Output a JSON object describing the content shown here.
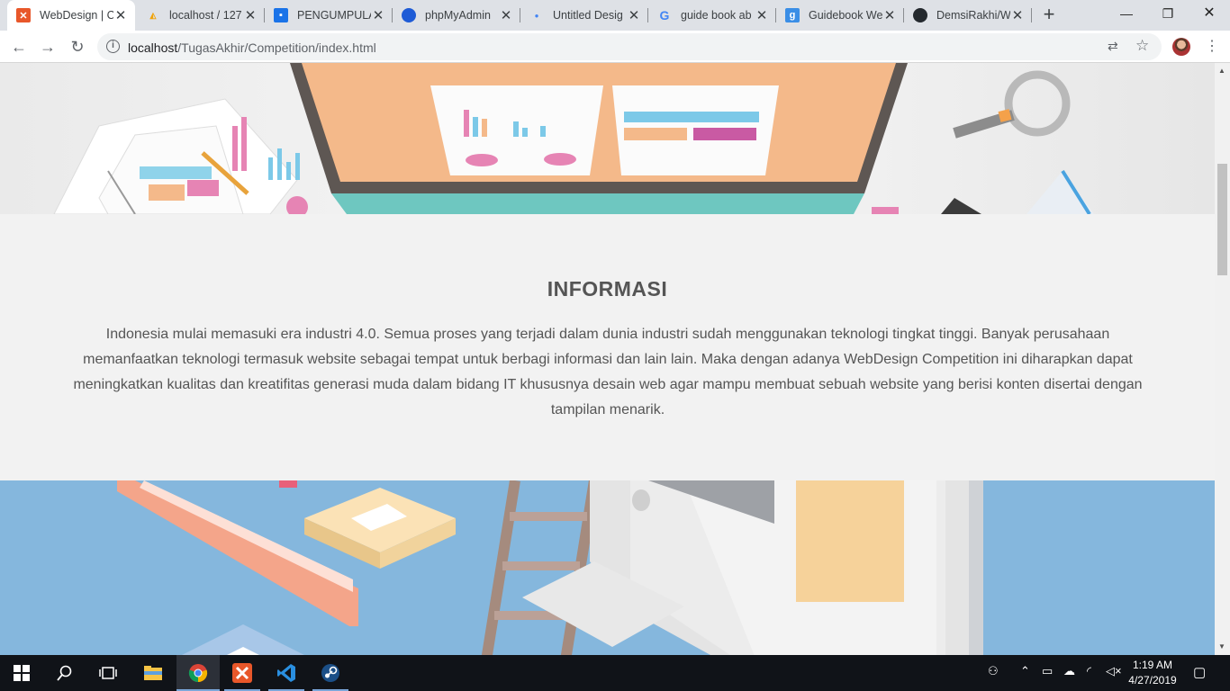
{
  "browser": {
    "tabs": [
      {
        "title": "WebDesign | C",
        "favicon": "xampp-icon",
        "color": "#e8572a"
      },
      {
        "title": "localhost / 127",
        "favicon": "phpmyadmin-icon",
        "color": "#f0a30a"
      },
      {
        "title": "PENGUMPULA",
        "favicon": "classroom-icon",
        "color": "#1a73e8"
      },
      {
        "title": "phpMyAdmin",
        "favicon": "edge-icon",
        "color": "#1e5bd6"
      },
      {
        "title": "Untitled Desig",
        "favicon": "dot-icon",
        "color": "#4285f4"
      },
      {
        "title": "guide book ab",
        "favicon": "google-icon",
        "color": "#4285f4"
      },
      {
        "title": "Guidebook We",
        "favicon": "g-square-icon",
        "color": "#3a8ee6"
      },
      {
        "title": "DemsiRakhi/W",
        "favicon": "github-icon",
        "color": "#24292e"
      }
    ],
    "url_host": "localhost",
    "url_path": "/TugasAkhir/Competition/index.html"
  },
  "page": {
    "info_title": "INFORMASI",
    "info_text": "Indonesia mulai memasuki era industri 4.0. Semua proses yang terjadi dalam dunia industri sudah menggunakan teknologi tingkat tinggi. Banyak perusahaan memanfaatkan teknologi termasuk website sebagai tempat untuk berbagi informasi dan lain lain. Maka dengan adanya WebDesign Competition ini diharapkan dapat meningkatkan kualitas dan kreatifitas generasi muda dalam bidang IT khususnya desain web agar mampu membuat sebuah website yang berisi konten disertai dengan tampilan menarik."
  },
  "taskbar": {
    "time": "1:19 AM",
    "date": "4/27/2019"
  },
  "colors": {
    "hero_bottom_bg": "#85b7dd",
    "section_bg": "#f2f2f2",
    "taskbar_bg": "#101318"
  }
}
